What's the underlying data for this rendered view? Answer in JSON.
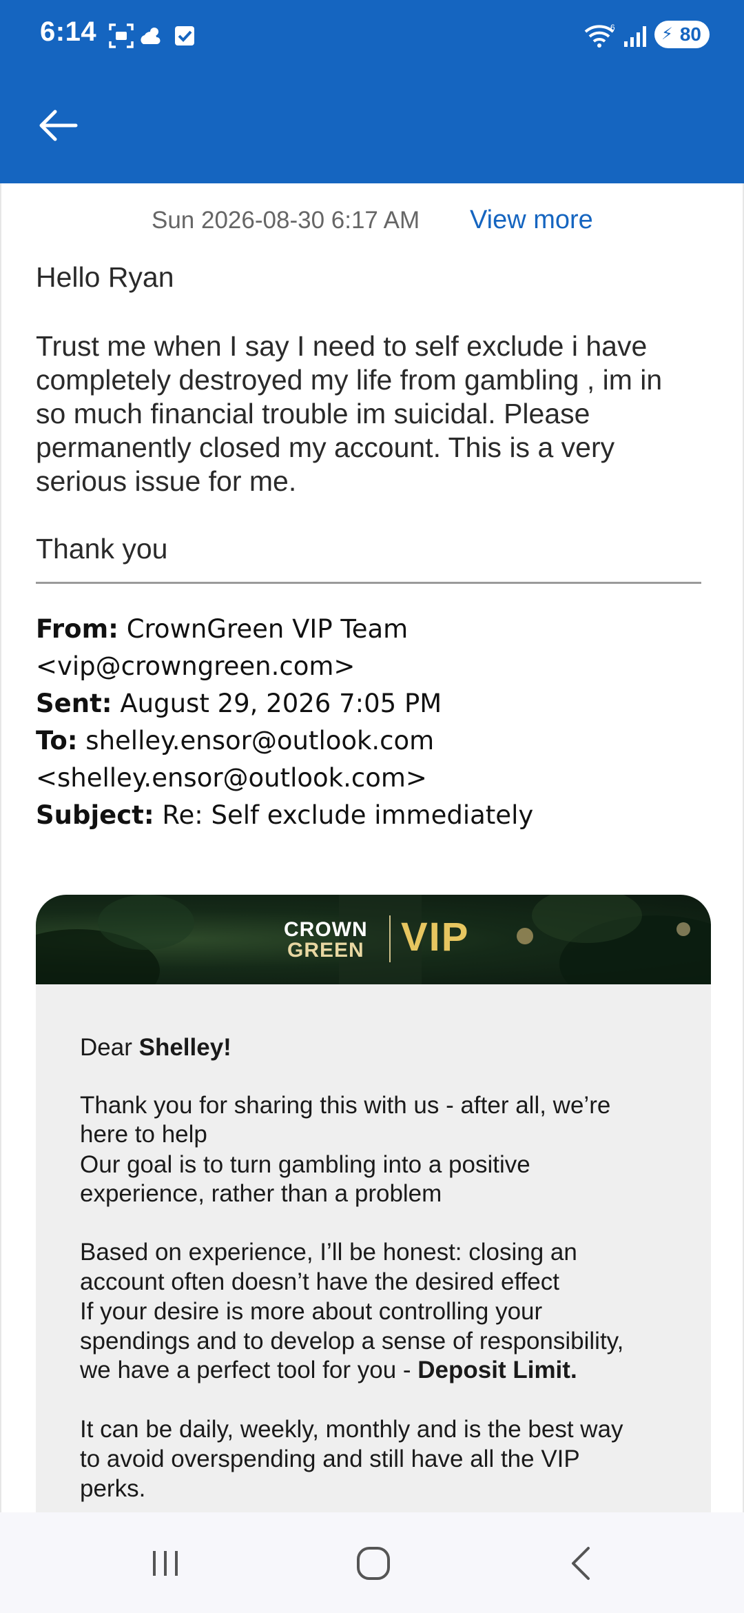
{
  "status_bar": {
    "time": "6:14",
    "battery": "80",
    "icons": [
      "screenshot-icon",
      "weather-icon",
      "checkbox-notification-icon",
      "wifi-icon",
      "signal-icon",
      "battery-icon"
    ]
  },
  "header": {
    "back_icon": "arrow-left-icon"
  },
  "email": {
    "date": "Sun 2026-08-30 6:17 AM",
    "view_more": "View more",
    "greeting": "Hello Ryan",
    "paragraph": "Trust me when I say I need to self exclude i have completely destroyed my life from gambling , im in so much financial trouble im suicidal. Please permanently closed my account. This is a very serious issue for me.",
    "closing": "Thank you"
  },
  "quoted_headers": {
    "from_label": "From:",
    "from_value": " CrownGreen VIP Team <vip@crowngreen.com>",
    "sent_label": "Sent:",
    "sent_value": " August 29, 2026 7:05 PM",
    "to_label": "To:",
    "to_value": " shelley.ensor@outlook.com",
    "to_value2": "<shelley.ensor@outlook.com>",
    "subject_label": "Subject:",
    "subject_value": " Re: Self exclude immediately"
  },
  "card": {
    "logo_crown": "CROWN",
    "logo_green": "GREEN",
    "logo_vip": "VIP",
    "dear": "Dear ",
    "name": "Shelley!",
    "l1": "Thank you for sharing this with us - after all, we’re",
    "l2": "here to help",
    "l3": "Our goal is to turn gambling into a positive",
    "l4": "experience, rather than a problem",
    "l5": "Based on experience, I’ll be honest: closing an",
    "l6": "account often doesn’t have the desired effect",
    "l7": "If your desire is more about controlling your",
    "l8": "spendings and to develop a sense of responsibility,",
    "l9a": "we have a perfect tool for you - ",
    "l9b": "Deposit Limit.",
    "l10": "It can be daily, weekly, monthly and is the best way",
    "l11": "to avoid overspending and still have all the VIP",
    "l12": "perks."
  },
  "nav": {
    "icons": [
      "recents-icon",
      "home-icon",
      "back-icon"
    ]
  },
  "colors": {
    "appbar": "#1565c0",
    "link": "#1565c0",
    "card_bg": "#efefef",
    "vip_gold": "#e7c660"
  }
}
